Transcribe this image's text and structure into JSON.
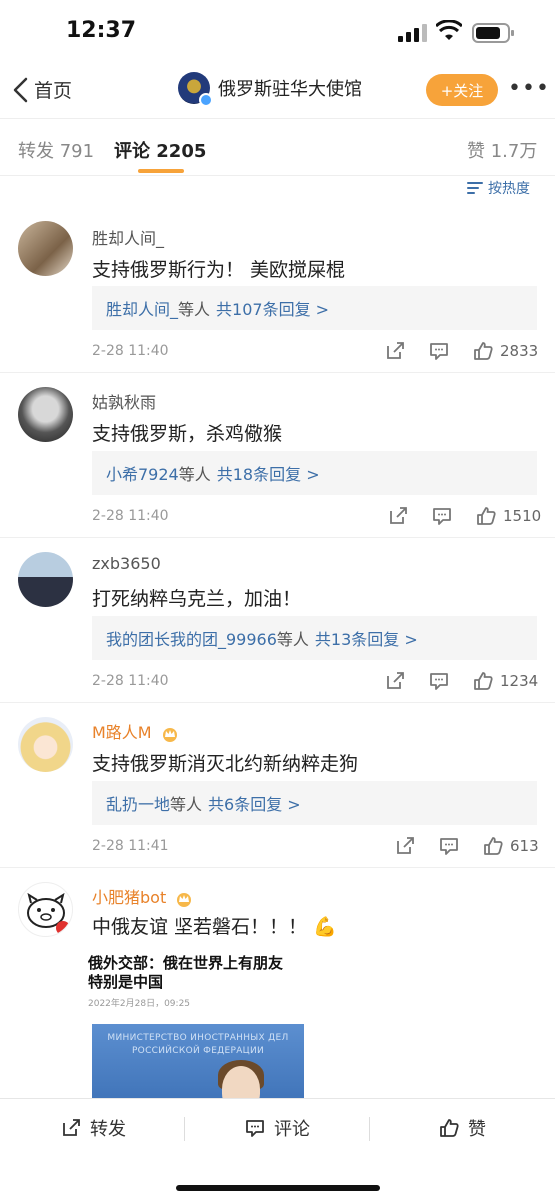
{
  "status": {
    "time": "12:37"
  },
  "nav": {
    "back_label": "首页",
    "title": "俄罗斯驻华大使馆",
    "follow_label": "+关注",
    "more_label": "•••"
  },
  "tabs": {
    "repost": "转发 791",
    "comments": "评论 2205",
    "likes": "赞 1.7万"
  },
  "sort_label": "按热度",
  "comments": [
    {
      "name": "胜却人间_",
      "text": "支持俄罗斯行为！ 美欧搅屎棍",
      "reply_users": "胜却人间_",
      "reply_mid": "等人",
      "reply_count": "共107条回复 >",
      "date": "2-28 11:40",
      "likes": "2833"
    },
    {
      "name": "姑孰秋雨",
      "text": "支持俄罗斯，杀鸡儆猴",
      "reply_users": "小希7924",
      "reply_mid": "等人",
      "reply_count": "共18条回复 >",
      "date": "2-28 11:40",
      "likes": "1510"
    },
    {
      "name": "zxb3650",
      "text": "打死纳粹乌克兰，加油！",
      "reply_users": "我的团长我的团_99966",
      "reply_mid": "等人",
      "reply_count": "共13条回复 >",
      "date": "2-28 11:40",
      "likes": "1234"
    },
    {
      "name": "M路人M",
      "text": "支持俄罗斯消灭北约新纳粹走狗",
      "reply_users": "乱扔一地",
      "reply_mid": "等人",
      "reply_count": "共6条回复 >",
      "date": "2-28 11:41",
      "likes": "613"
    },
    {
      "name": "小肥猪bot",
      "text": "中俄友谊 坚若磐石！！！",
      "emoji": "💪"
    }
  ],
  "embed": {
    "headline_1": "俄外交部：俄在世界上有朋友",
    "headline_2": "特别是中国",
    "date": "2022年2月28日，09:25",
    "sign_1": "МИНИСТЕРСТВО ИНОСТРАННЫХ ДЕЛ",
    "sign_2": "РОССИЙСКОЙ ФЕДЕРАЦИИ"
  },
  "bottom": {
    "repost": "转发",
    "comment": "评论",
    "like": "赞"
  },
  "colors": {
    "accent": "#f7a33a",
    "link": "#3d6fa8",
    "vip_name": "#e8822a"
  }
}
